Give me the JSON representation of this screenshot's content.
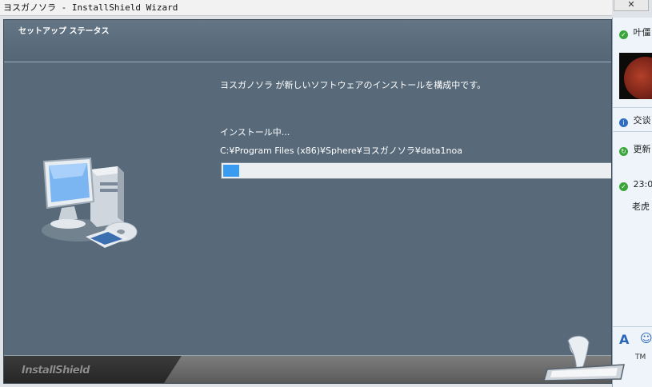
{
  "window": {
    "title": "ヨスガノソラ - InstallShield Wizard",
    "close_label": "✕"
  },
  "banner": {
    "title": "セットアップ ステータス"
  },
  "content": {
    "message": "ヨスガノソラ が新しいソフトウェアのインストールを構成中です。",
    "status": "インストール中...",
    "current_file": "C:¥Program Files (x86)¥Sphere¥ヨスガノソラ¥data1noa",
    "progress": 0.04
  },
  "footer": {
    "brand": "InstallShield"
  },
  "side_panel": {
    "name": "叶僵",
    "item_info": "交谈",
    "item_update": "更新",
    "time": "23:0",
    "msg": "老虎",
    "font_tool": "A",
    "emoji_tool": "☺",
    "small": "TM"
  },
  "colors": {
    "window_bg": "#586a7a",
    "accent": "#3a9cf0"
  }
}
